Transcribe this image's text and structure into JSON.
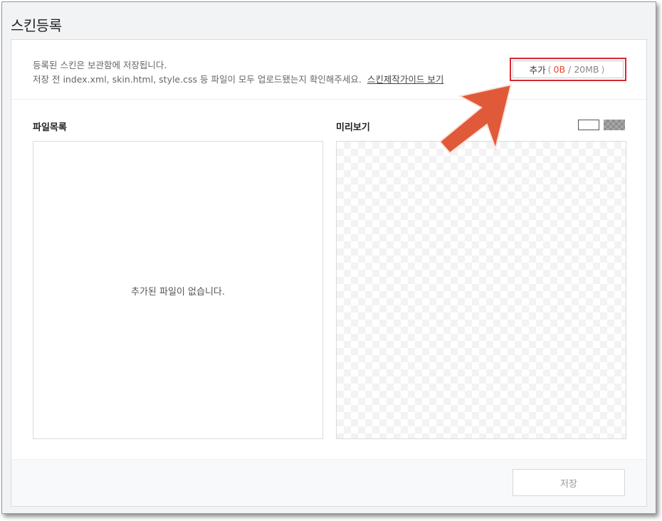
{
  "window": {
    "title": "스킨등록"
  },
  "notice": {
    "line1": "등록된 스킨은 보관함에 저장됩니다.",
    "line2": "저장 전 index.xml, skin.html, style.css 등 파일이 모두 업로드됐는지 확인해주세요.",
    "guide_link": "스킨제작가이드 보기"
  },
  "add_button": {
    "label": "추가",
    "open_paren": "(",
    "used": "0B",
    "separator": " / ",
    "total": "20MB",
    "close_paren": ")"
  },
  "files": {
    "title": "파일목록",
    "empty_message": "추가된 파일이 없습니다."
  },
  "preview": {
    "title": "미리보기"
  },
  "footer": {
    "save_label": "저장"
  },
  "colors": {
    "highlight_border": "#d42a33",
    "arrow": "#e05a3a",
    "used_size": "#e4472c"
  },
  "icons": {
    "annotation_arrow": "arrow-up-right-icon",
    "preview_bg_white": "white-background-swatch",
    "preview_bg_gray": "gray-checker-background-swatch"
  }
}
